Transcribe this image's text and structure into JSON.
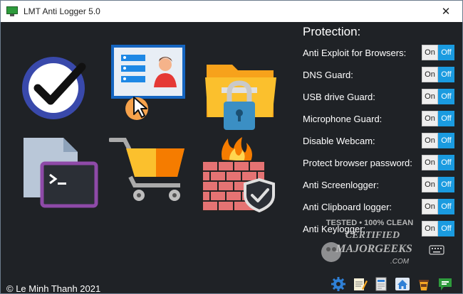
{
  "window": {
    "title": "LMT Anti Logger 5.0",
    "close_symbol": "✕"
  },
  "tiles": [
    {
      "name": "clock-check-icon"
    },
    {
      "name": "user-profile-icon"
    },
    {
      "name": "locked-folder-icon"
    },
    {
      "name": "terminal-file-icon"
    },
    {
      "name": "shopping-cart-icon"
    },
    {
      "name": "firewall-shield-icon"
    }
  ],
  "protection": {
    "title": "Protection:",
    "on_label": "On",
    "off_label": "Off",
    "options": [
      {
        "label": "Anti Exploit for Browsers:",
        "state": "Off"
      },
      {
        "label": "DNS Guard:",
        "state": "Off"
      },
      {
        "label": "USB drive Guard:",
        "state": "Off"
      },
      {
        "label": "Microphone Guard:",
        "state": "Off"
      },
      {
        "label": "Disable Webcam:",
        "state": "Off"
      },
      {
        "label": "Protect browser password:",
        "state": "Off"
      },
      {
        "label": "Anti Screenlogger:",
        "state": "Off"
      },
      {
        "label": "Anti Clipboard logger:",
        "state": "Off"
      },
      {
        "label": "Anti Keylogger:",
        "state": "Off"
      }
    ]
  },
  "watermark": {
    "line1": "TESTED • 100% CLEAN",
    "line2": "CERTIFIED",
    "line3": "MAJORGEEKS",
    "line4": ".COM"
  },
  "footer": {
    "copyright": "© Le Minh Thanh 2021",
    "tray_icons": [
      "settings-gear-icon",
      "notepad-icon",
      "document-icon",
      "home-icon",
      "coffee-cup-icon",
      "message-icon"
    ]
  },
  "colors": {
    "background": "#1f2226",
    "toggle_off": "#1a9be0",
    "toggle_on_bg": "#eeeeee"
  }
}
